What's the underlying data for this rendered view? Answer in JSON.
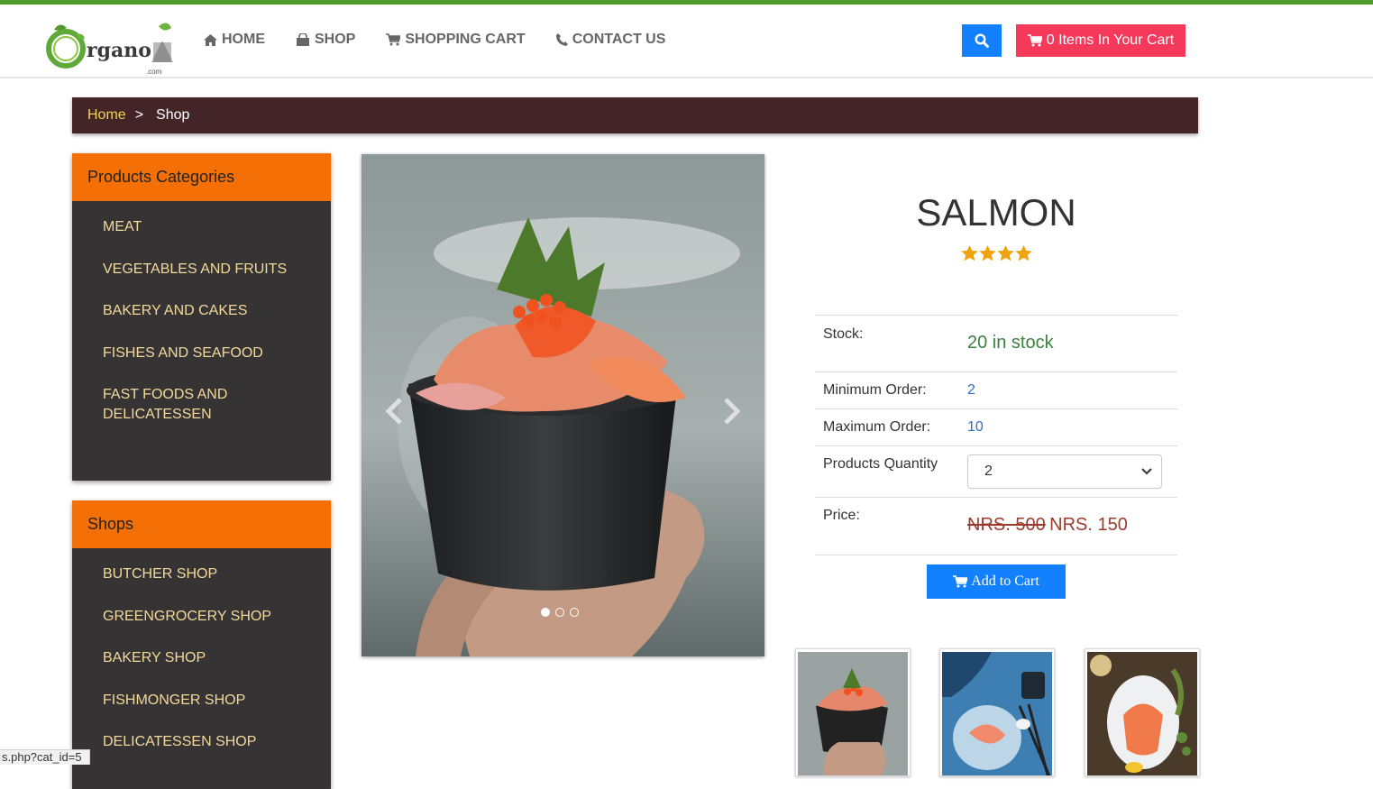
{
  "header": {
    "logo_text": "rgano",
    "logo_suffix": ".com",
    "nav": [
      {
        "label": "HOME",
        "icon": "home-icon"
      },
      {
        "label": "SHOP",
        "icon": "shopping-bag-icon"
      },
      {
        "label": "SHOPPING CART",
        "icon": "cart-icon"
      },
      {
        "label": "CONTACT US",
        "icon": "phone-icon"
      }
    ],
    "cart_label": "0 Items In Your Cart"
  },
  "breadcrumb": {
    "home": "Home",
    "separator": ">",
    "current": "Shop"
  },
  "sidebar": {
    "categories": {
      "title": "Products Categories",
      "items": [
        "MEAT",
        "VEGETABLES AND FRUITS",
        "BAKERY AND CAKES",
        "FISHES AND SEAFOOD",
        "FAST FOODS AND DELICATESSEN"
      ]
    },
    "shops": {
      "title": "Shops",
      "items": [
        "BUTCHER SHOP",
        "GREENGROCERY SHOP",
        "BAKERY SHOP",
        "FISHMONGER SHOP",
        "DELICATESSEN SHOP"
      ]
    }
  },
  "product": {
    "name": "SALMON",
    "rating": 4,
    "stock_label": "Stock:",
    "stock_value": "20 in stock",
    "min_label": "Minimum Order:",
    "min_value": "2",
    "max_label": "Maximum Order:",
    "max_value": "10",
    "qty_label": "Products Quantity",
    "qty_selected": "2",
    "price_label": "Price:",
    "price_old": "NRS. 500",
    "price_new": "NRS. 150",
    "add_to_cart": "Add to Cart"
  },
  "carousel": {
    "slide_count": 3,
    "active_slide": 1
  },
  "status_bar": {
    "url": "s.php?cat_id=5"
  },
  "colors": {
    "accent_green": "#4e9a2b",
    "primary_blue": "#1380ff",
    "cart_pink": "#f4395a",
    "panel_orange": "#f47007",
    "panel_dark": "#363334",
    "breadcrumb_bg": "#432527",
    "link_yellow": "#f3d99a",
    "star": "#f0a30a"
  }
}
